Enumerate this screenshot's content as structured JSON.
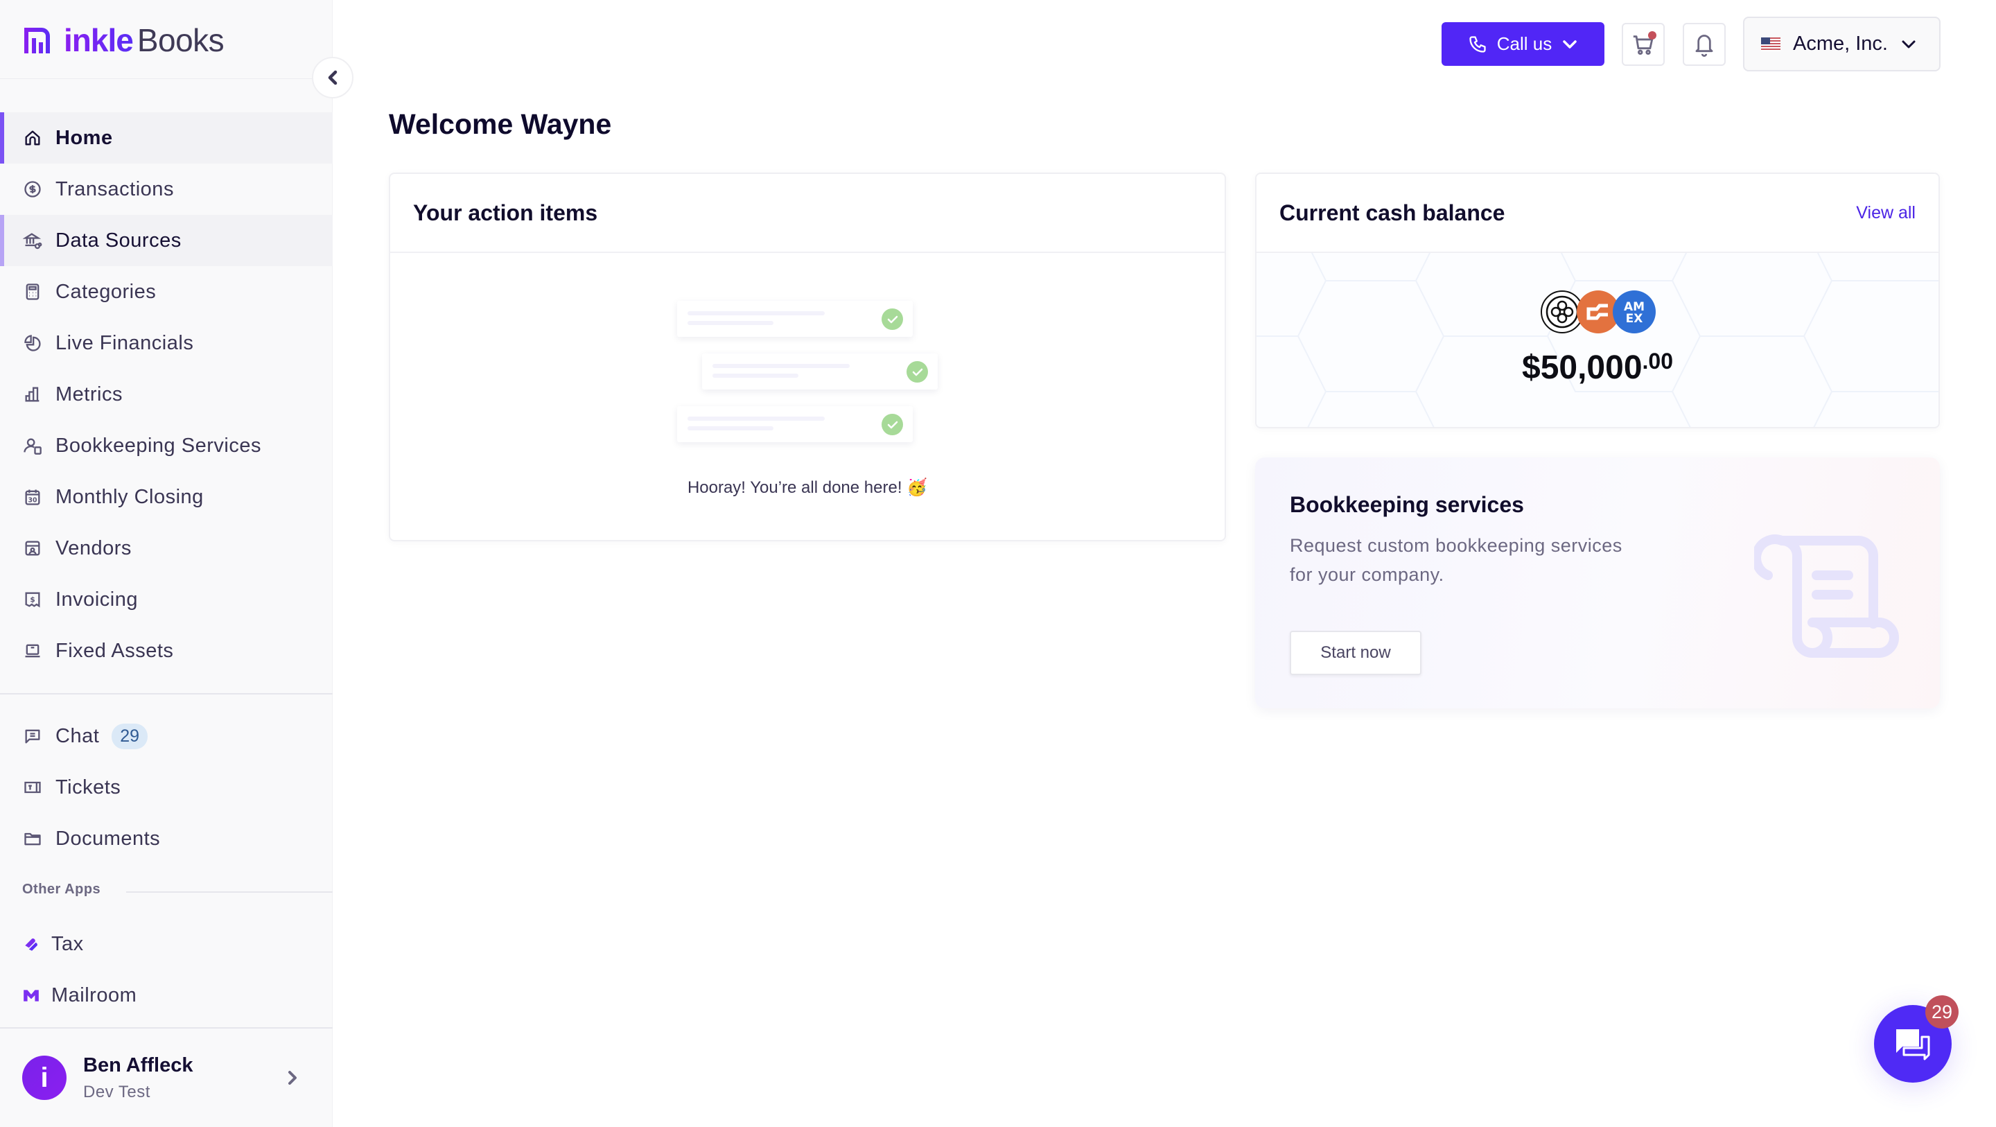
{
  "brand": {
    "name_part1": "inkle",
    "name_part2": "Books",
    "accent": "#5126f6"
  },
  "sidebar": {
    "collapse_label": "Collapse sidebar",
    "items": [
      {
        "label": "Home",
        "icon": "home-icon",
        "state": "active"
      },
      {
        "label": "Transactions",
        "icon": "dollar-circle-icon"
      },
      {
        "label": "Data Sources",
        "icon": "bank-link-icon",
        "state": "hovered"
      },
      {
        "label": "Categories",
        "icon": "calculator-icon"
      },
      {
        "label": "Live Financials",
        "icon": "pie-chart-icon"
      },
      {
        "label": "Metrics",
        "icon": "bar-chart-icon"
      },
      {
        "label": "Bookkeeping Services",
        "icon": "user-calculator-icon"
      },
      {
        "label": "Monthly Closing",
        "icon": "calendar-30-icon"
      },
      {
        "label": "Vendors",
        "icon": "store-icon"
      },
      {
        "label": "Invoicing",
        "icon": "receipt-icon"
      },
      {
        "label": "Fixed Assets",
        "icon": "laptop-icon"
      }
    ],
    "secondary": [
      {
        "label": "Chat",
        "icon": "chat-icon",
        "badge": "29"
      },
      {
        "label": "Tickets",
        "icon": "ticket-icon"
      },
      {
        "label": "Documents",
        "icon": "folder-icon"
      }
    ],
    "other_apps_label": "Other Apps",
    "apps": [
      {
        "label": "Tax",
        "icon": "tax-logo-icon"
      },
      {
        "label": "Mailroom",
        "icon": "mailroom-logo-icon"
      }
    ],
    "user": {
      "name": "Ben Affleck",
      "subtitle": "Dev Test",
      "avatar_letter": "i"
    }
  },
  "header": {
    "call_label": "Call us",
    "cart_has_notification": true,
    "company": {
      "name": "Acme, Inc.",
      "country": "US"
    }
  },
  "main": {
    "title": "Welcome Wayne",
    "action_items": {
      "title": "Your action items",
      "empty_message": "Hooray! You’re all done here! 🥳",
      "illustration_cards": 3
    },
    "cash": {
      "title": "Current cash balance",
      "view_all": "View all",
      "amount_main": "$50,000",
      "amount_cents": ".00",
      "banks": [
        "Bank 1",
        "Brex",
        "AMEX"
      ]
    },
    "bookkeeping": {
      "title": "Bookkeeping services",
      "description": "Request custom bookkeeping services for your company.",
      "button": "Start now"
    }
  },
  "chat_widget": {
    "badge": "29"
  }
}
